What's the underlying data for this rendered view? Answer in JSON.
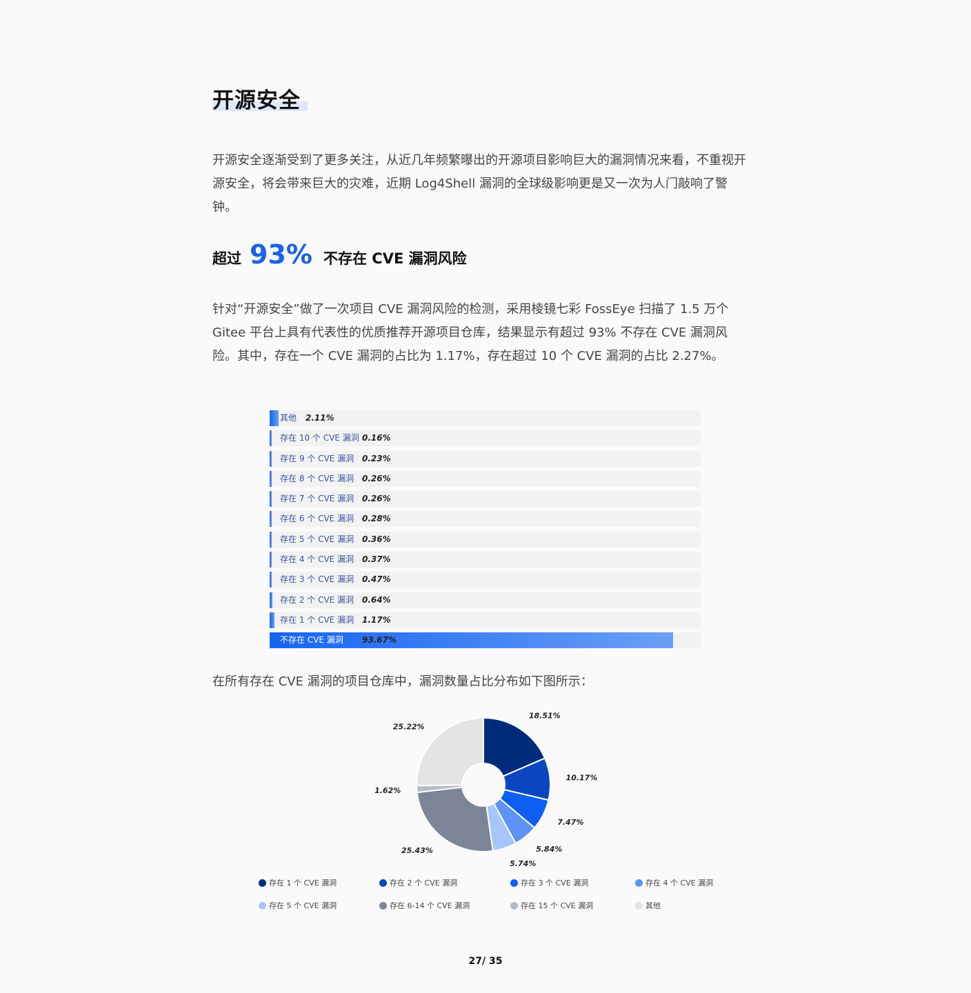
{
  "title": "开源安全",
  "intro": "开源安全逐渐受到了更多关注，从近几年频繁曝出的开源项目影响巨大的漏洞情况来看，不重视开源安全，将会带来巨大的灾难，近期 Log4Shell 漏洞的全球级影响更是又一次为人门敲响了警钟。",
  "subhead": {
    "prefix": "超过",
    "highlight": "93%",
    "suffix": "不存在 CVE 漏洞风险"
  },
  "detail": "针对“开源安全”做了一次项目 CVE 漏洞风险的检测，采用棱镜七彩 FossEye 扫描了 1.5 万个 Gitee 平台上具有代表性的优质推荐开源项目仓库，结果显示有超过 93% 不存在 CVE 漏洞风险。其中，存在一个 CVE 漏洞的占比为 1.17%，存在超过 10 个 CVE 漏洞的占比 2.27%。",
  "pie_intro": "在所有存在 CVE 漏洞的项目仓库中，漏洞数量占比分布如下图所示：",
  "page": "27/ 35",
  "chart_data": [
    {
      "type": "bar",
      "orientation": "horizontal",
      "categories": [
        "其他",
        "存在 10 个 CVE 漏洞",
        "存在 9 个 CVE 漏洞",
        "存在 8 个 CVE 漏洞",
        "存在 7 个 CVE 漏洞",
        "存在 6 个 CVE 漏洞",
        "存在 5 个 CVE 漏洞",
        "存在 4 个 CVE 漏洞",
        "存在 3 个 CVE 漏洞",
        "存在 2 个 CVE 漏洞",
        "存在 1 个 CVE 漏洞",
        "不存在 CVE 漏洞"
      ],
      "values": [
        2.11,
        0.16,
        0.23,
        0.26,
        0.26,
        0.28,
        0.36,
        0.37,
        0.47,
        0.64,
        1.17,
        93.67
      ],
      "value_labels": [
        "2.11%",
        "0.16%",
        "0.23%",
        "0.26%",
        "0.26%",
        "0.28%",
        "0.36%",
        "0.37%",
        "0.47%",
        "0.64%",
        "1.17%",
        "93.67%"
      ],
      "xlim": [
        0,
        100
      ],
      "color": "#1764f0"
    },
    {
      "type": "pie",
      "donut": true,
      "categories": [
        "存在 1 个 CVE 漏洞",
        "存在 2 个 CVE 漏洞",
        "存在 3 个 CVE 漏洞",
        "存在 4 个 CVE 漏洞",
        "存在 5 个 CVE 漏洞",
        "存在 6-14 个 CVE 漏洞",
        "存在 15 个 CVE 漏洞",
        "其他"
      ],
      "values": [
        18.51,
        10.17,
        7.47,
        5.84,
        5.74,
        25.43,
        1.62,
        25.22
      ],
      "value_labels": [
        "18.51%",
        "10.17%",
        "7.47%",
        "5.84%",
        "5.74%",
        "25.43%",
        "1.62%",
        "25.22%"
      ],
      "colors": [
        "#002b7a",
        "#0a45c2",
        "#0f5ef2",
        "#5d93f5",
        "#a6c6fb",
        "#7b8597",
        "#b4bcc7",
        "#e4e4e4"
      ],
      "legend_placement": "bottom"
    }
  ]
}
